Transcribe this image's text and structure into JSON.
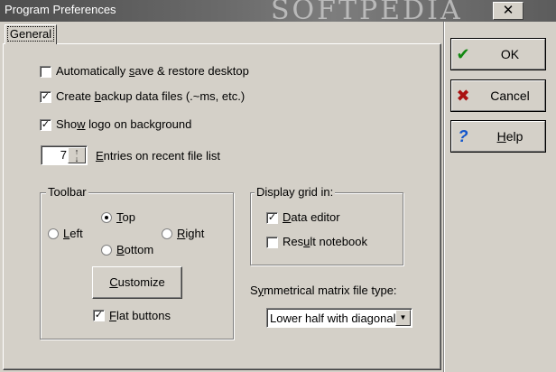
{
  "window": {
    "title": "Program Preferences",
    "watermark": "SOFTPEDIA",
    "close_glyph": "✕"
  },
  "tabs": [
    {
      "label": "General",
      "active": true
    }
  ],
  "options": {
    "auto_save": {
      "label": "Automatically save & restore desktop",
      "checked": false
    },
    "backup": {
      "label": "Create backup data files (.~ms, etc.)",
      "checked": true
    },
    "show_logo": {
      "label": "Show logo on background",
      "checked": true
    }
  },
  "recent_files": {
    "value": "7",
    "label": "Entries on recent file list"
  },
  "toolbar": {
    "title": "Toolbar",
    "positions": {
      "left": "Left",
      "top": "Top",
      "right": "Right",
      "bottom": "Bottom"
    },
    "selected": "top",
    "customize_label": "Customize",
    "flat_buttons": {
      "label": "Flat buttons",
      "checked": true
    }
  },
  "display_grid": {
    "title": "Display grid in:",
    "data_editor": {
      "label": "Data editor",
      "checked": true
    },
    "result_notebook": {
      "label": "Result notebook",
      "checked": false
    }
  },
  "matrix": {
    "label": "Symmetrical matrix file type:",
    "value": "Lower half with diagonal"
  },
  "buttons": {
    "ok": {
      "label": "OK",
      "icon": "check-icon",
      "color": "#118811"
    },
    "cancel": {
      "label": "Cancel",
      "icon": "x-icon",
      "color": "#aa1111"
    },
    "help": {
      "label": "Help",
      "icon": "question-icon",
      "color": "#1155cc"
    }
  }
}
